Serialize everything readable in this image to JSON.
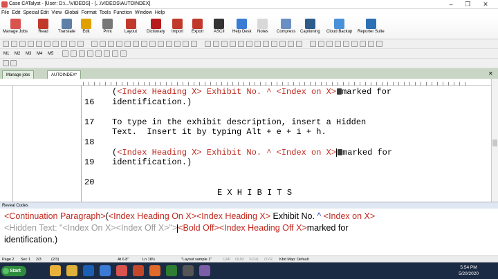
{
  "window": {
    "title": "Case CATalyst - [User: D:\\...\\VIDEOS] - [...\\VIDEOS\\AUTOINDEX]"
  },
  "menu": [
    "File",
    "Edit",
    "Special Edit",
    "View",
    "Global",
    "Format",
    "Tools",
    "Function",
    "Window",
    "Help"
  ],
  "ribbon": [
    {
      "label": "Manage Jobs",
      "color": "#d9534f"
    },
    {
      "label": "Read",
      "color": "#c0392b"
    },
    {
      "label": "Translate",
      "color": "#5d7fa8"
    },
    {
      "label": "Edit",
      "color": "#e0a100"
    },
    {
      "label": "Print",
      "color": "#777777"
    },
    {
      "label": "Layout",
      "color": "#c0392b"
    },
    {
      "label": "Dictionary",
      "color": "#b71c1c"
    },
    {
      "label": "Import",
      "color": "#c0392b"
    },
    {
      "label": "Export",
      "color": "#c0392b"
    },
    {
      "label": "ASCII",
      "color": "#333333"
    },
    {
      "label": "Help Desk",
      "color": "#3a7bd5"
    },
    {
      "label": "Notes",
      "color": "#d8d8d8"
    },
    {
      "label": "Compress",
      "color": "#6a8fc2"
    },
    {
      "label": "Captioning",
      "color": "#2d5c8a"
    },
    {
      "label": "Cloud Backup",
      "color": "#4a90d9"
    },
    {
      "label": "Reporter Suite",
      "color": "#2c6fb5"
    }
  ],
  "marks": [
    "M1",
    "M2",
    "M3",
    "M4",
    "M5"
  ],
  "tabs": [
    {
      "label": "Manage jobs"
    },
    {
      "label": "AUTOINDEX*"
    }
  ],
  "document": {
    "lines": [
      {
        "num": "",
        "parts": [
          {
            "t": "(",
            "c": "black"
          },
          {
            "t": "<Index Heading X> Exhibit No. ^ <Index on X>",
            "c": "red"
          },
          {
            "t": "marked for",
            "c": "black"
          }
        ]
      },
      {
        "num": "16",
        "parts": [
          {
            "t": "identification.)",
            "c": "black"
          }
        ]
      },
      {
        "num": "17",
        "parts": [
          {
            "t": "To type in the exhibit description, insert a Hidden",
            "c": "black"
          }
        ]
      },
      {
        "num": "",
        "parts": [
          {
            "t": "Text.  Insert it by typing Alt + e + i + h.",
            "c": "black"
          }
        ]
      },
      {
        "num": "18",
        "parts": []
      },
      {
        "num": "",
        "parts": [
          {
            "t": "(",
            "c": "black"
          },
          {
            "t": "<Index Heading X> Exhibit No. ^ <Index on X>",
            "c": "red"
          },
          {
            "t": "marked for",
            "c": "black"
          }
        ]
      },
      {
        "num": "19",
        "parts": [
          {
            "t": "identification.)",
            "c": "black"
          }
        ]
      },
      {
        "num": "20",
        "parts": []
      },
      {
        "num": "",
        "parts": [
          {
            "t": "E X H I B I T S",
            "c": "black"
          }
        ]
      }
    ]
  },
  "reveal_codes": {
    "header": "Reveal Codes",
    "line1": [
      {
        "t": "<Continuation Paragraph>",
        "c": "red"
      },
      {
        "t": "(",
        "c": "black"
      },
      {
        "t": "<Index Heading On X>",
        "c": "red"
      },
      {
        "t": "<Index Heading X>",
        "c": "red"
      },
      {
        "t": " Exhibit No. ",
        "c": "black"
      },
      {
        "t": "^",
        "c": "blue"
      },
      {
        "t": " ",
        "c": "black"
      },
      {
        "t": "<Index on X>",
        "c": "red"
      }
    ],
    "line2": [
      {
        "t": "<Hidden Text: \"<Index On X><Index Off X>\">",
        "c": "gray"
      },
      {
        "t": "<Bold Off>",
        "c": "red"
      },
      {
        "t": "<Index Heading Off X>",
        "c": "red"
      },
      {
        "t": "marked for",
        "c": "black"
      }
    ],
    "line3": [
      {
        "t": "identification.)",
        "c": "black"
      }
    ]
  },
  "status": {
    "page": "Page 2",
    "sec": "Sec 1",
    "pos": "2/3",
    "pos2": "(2/3)",
    "at": "At 6.8\"",
    "line": "Ln 18½",
    "layout": "\"Layout sample 1\"",
    "caps": "CAP",
    "num": "NUM",
    "scrl": "SCRL",
    "ovr": "OVR",
    "kbd": "Kbd Map: Default"
  },
  "taskbar": {
    "start": "Start",
    "time": "5:54 PM",
    "date": "5/20/2020",
    "icons": [
      {
        "name": "folder",
        "color": "#e8b23a"
      },
      {
        "name": "chrome",
        "color": "#dfb13a"
      },
      {
        "name": "media",
        "color": "#1a5fb4"
      },
      {
        "name": "ie",
        "color": "#3a7bd5"
      },
      {
        "name": "catalyst",
        "color": "#d9534f"
      },
      {
        "name": "ppt",
        "color": "#c4472a"
      },
      {
        "name": "firefox",
        "color": "#e06b2a"
      },
      {
        "name": "app",
        "color": "#2f7d32"
      },
      {
        "name": "video",
        "color": "#555555"
      },
      {
        "name": "app2",
        "color": "#7b5ea7"
      }
    ]
  }
}
